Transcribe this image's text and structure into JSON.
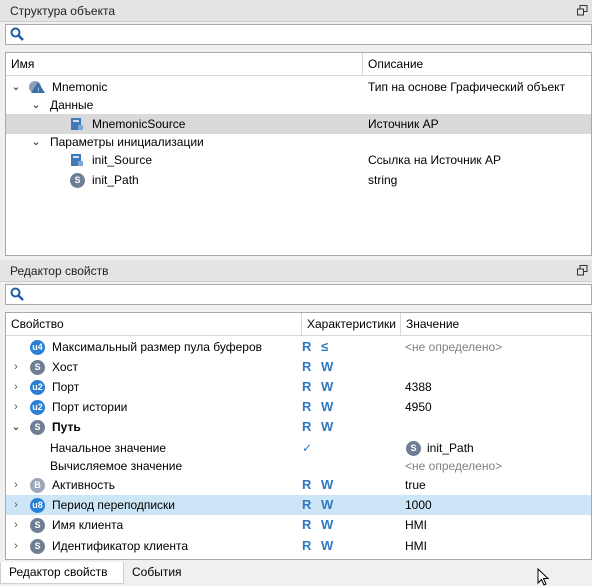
{
  "structure_panel": {
    "title": "Структура объекта",
    "columns": {
      "name": "Имя",
      "description": "Описание"
    },
    "rows": [
      {
        "name": "Mnemonic",
        "description": "Тип на основе Графический объект"
      },
      {
        "name": "Данные",
        "description": ""
      },
      {
        "name": "MnemonicSource",
        "description": "Источник АР"
      },
      {
        "name": "Параметры инициализации",
        "description": ""
      },
      {
        "name": "init_Source",
        "description": "Ссылка на Источник АР"
      },
      {
        "name": "init_Path",
        "description": "string"
      }
    ]
  },
  "properties_panel": {
    "title": "Редактор свойств",
    "columns": {
      "property": "Свойство",
      "characteristics": "Характеристики",
      "value": "Значение"
    },
    "rows": [
      {
        "badge": "u4",
        "name": "Максимальный размер пула буферов",
        "chars": "R ≤",
        "value": "<не определено>"
      },
      {
        "badge": "S",
        "name": "Хост",
        "chars": "R W",
        "value": ""
      },
      {
        "badge": "u2",
        "name": "Порт",
        "chars": "R W",
        "value": "4388"
      },
      {
        "badge": "u2",
        "name": "Порт истории",
        "chars": "R W",
        "value": "4950"
      },
      {
        "badge": "S",
        "name": "Путь",
        "chars": "R W",
        "value": ""
      },
      {
        "badge": "",
        "name": "Начальное значение",
        "chars": "✓",
        "value": "init_Path",
        "value_badge": "S"
      },
      {
        "badge": "",
        "name": "Вычисляемое значение",
        "chars": "",
        "value": "<не определено>"
      },
      {
        "badge": "B",
        "name": "Активность",
        "chars": "R W",
        "value": "true"
      },
      {
        "badge": "u8",
        "name": "Период переподписки",
        "chars": "R W",
        "value": "1000"
      },
      {
        "badge": "S",
        "name": "Имя клиента",
        "chars": "R W",
        "value": "HMI"
      },
      {
        "badge": "S",
        "name": "Идентификатор клиента",
        "chars": "R W",
        "value": "HMI"
      }
    ]
  },
  "tabs": [
    "Редактор свойств",
    "События"
  ],
  "icons": {
    "search": "search-icon",
    "float": "float-window-icon",
    "cursor": "mouse-cursor-icon"
  }
}
